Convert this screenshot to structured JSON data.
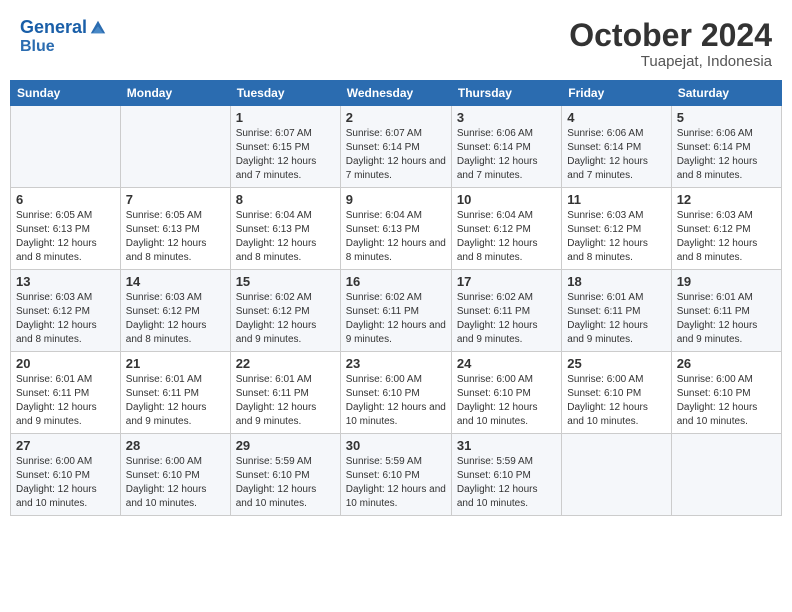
{
  "header": {
    "logo_line1": "General",
    "logo_line2": "Blue",
    "month": "October 2024",
    "location": "Tuapejat, Indonesia"
  },
  "weekdays": [
    "Sunday",
    "Monday",
    "Tuesday",
    "Wednesday",
    "Thursday",
    "Friday",
    "Saturday"
  ],
  "weeks": [
    [
      {
        "day": "",
        "sunrise": "",
        "sunset": "",
        "daylight": ""
      },
      {
        "day": "",
        "sunrise": "",
        "sunset": "",
        "daylight": ""
      },
      {
        "day": "1",
        "sunrise": "Sunrise: 6:07 AM",
        "sunset": "Sunset: 6:15 PM",
        "daylight": "Daylight: 12 hours and 7 minutes."
      },
      {
        "day": "2",
        "sunrise": "Sunrise: 6:07 AM",
        "sunset": "Sunset: 6:14 PM",
        "daylight": "Daylight: 12 hours and 7 minutes."
      },
      {
        "day": "3",
        "sunrise": "Sunrise: 6:06 AM",
        "sunset": "Sunset: 6:14 PM",
        "daylight": "Daylight: 12 hours and 7 minutes."
      },
      {
        "day": "4",
        "sunrise": "Sunrise: 6:06 AM",
        "sunset": "Sunset: 6:14 PM",
        "daylight": "Daylight: 12 hours and 7 minutes."
      },
      {
        "day": "5",
        "sunrise": "Sunrise: 6:06 AM",
        "sunset": "Sunset: 6:14 PM",
        "daylight": "Daylight: 12 hours and 8 minutes."
      }
    ],
    [
      {
        "day": "6",
        "sunrise": "Sunrise: 6:05 AM",
        "sunset": "Sunset: 6:13 PM",
        "daylight": "Daylight: 12 hours and 8 minutes."
      },
      {
        "day": "7",
        "sunrise": "Sunrise: 6:05 AM",
        "sunset": "Sunset: 6:13 PM",
        "daylight": "Daylight: 12 hours and 8 minutes."
      },
      {
        "day": "8",
        "sunrise": "Sunrise: 6:04 AM",
        "sunset": "Sunset: 6:13 PM",
        "daylight": "Daylight: 12 hours and 8 minutes."
      },
      {
        "day": "9",
        "sunrise": "Sunrise: 6:04 AM",
        "sunset": "Sunset: 6:13 PM",
        "daylight": "Daylight: 12 hours and 8 minutes."
      },
      {
        "day": "10",
        "sunrise": "Sunrise: 6:04 AM",
        "sunset": "Sunset: 6:12 PM",
        "daylight": "Daylight: 12 hours and 8 minutes."
      },
      {
        "day": "11",
        "sunrise": "Sunrise: 6:03 AM",
        "sunset": "Sunset: 6:12 PM",
        "daylight": "Daylight: 12 hours and 8 minutes."
      },
      {
        "day": "12",
        "sunrise": "Sunrise: 6:03 AM",
        "sunset": "Sunset: 6:12 PM",
        "daylight": "Daylight: 12 hours and 8 minutes."
      }
    ],
    [
      {
        "day": "13",
        "sunrise": "Sunrise: 6:03 AM",
        "sunset": "Sunset: 6:12 PM",
        "daylight": "Daylight: 12 hours and 8 minutes."
      },
      {
        "day": "14",
        "sunrise": "Sunrise: 6:03 AM",
        "sunset": "Sunset: 6:12 PM",
        "daylight": "Daylight: 12 hours and 8 minutes."
      },
      {
        "day": "15",
        "sunrise": "Sunrise: 6:02 AM",
        "sunset": "Sunset: 6:12 PM",
        "daylight": "Daylight: 12 hours and 9 minutes."
      },
      {
        "day": "16",
        "sunrise": "Sunrise: 6:02 AM",
        "sunset": "Sunset: 6:11 PM",
        "daylight": "Daylight: 12 hours and 9 minutes."
      },
      {
        "day": "17",
        "sunrise": "Sunrise: 6:02 AM",
        "sunset": "Sunset: 6:11 PM",
        "daylight": "Daylight: 12 hours and 9 minutes."
      },
      {
        "day": "18",
        "sunrise": "Sunrise: 6:01 AM",
        "sunset": "Sunset: 6:11 PM",
        "daylight": "Daylight: 12 hours and 9 minutes."
      },
      {
        "day": "19",
        "sunrise": "Sunrise: 6:01 AM",
        "sunset": "Sunset: 6:11 PM",
        "daylight": "Daylight: 12 hours and 9 minutes."
      }
    ],
    [
      {
        "day": "20",
        "sunrise": "Sunrise: 6:01 AM",
        "sunset": "Sunset: 6:11 PM",
        "daylight": "Daylight: 12 hours and 9 minutes."
      },
      {
        "day": "21",
        "sunrise": "Sunrise: 6:01 AM",
        "sunset": "Sunset: 6:11 PM",
        "daylight": "Daylight: 12 hours and 9 minutes."
      },
      {
        "day": "22",
        "sunrise": "Sunrise: 6:01 AM",
        "sunset": "Sunset: 6:11 PM",
        "daylight": "Daylight: 12 hours and 9 minutes."
      },
      {
        "day": "23",
        "sunrise": "Sunrise: 6:00 AM",
        "sunset": "Sunset: 6:10 PM",
        "daylight": "Daylight: 12 hours and 10 minutes."
      },
      {
        "day": "24",
        "sunrise": "Sunrise: 6:00 AM",
        "sunset": "Sunset: 6:10 PM",
        "daylight": "Daylight: 12 hours and 10 minutes."
      },
      {
        "day": "25",
        "sunrise": "Sunrise: 6:00 AM",
        "sunset": "Sunset: 6:10 PM",
        "daylight": "Daylight: 12 hours and 10 minutes."
      },
      {
        "day": "26",
        "sunrise": "Sunrise: 6:00 AM",
        "sunset": "Sunset: 6:10 PM",
        "daylight": "Daylight: 12 hours and 10 minutes."
      }
    ],
    [
      {
        "day": "27",
        "sunrise": "Sunrise: 6:00 AM",
        "sunset": "Sunset: 6:10 PM",
        "daylight": "Daylight: 12 hours and 10 minutes."
      },
      {
        "day": "28",
        "sunrise": "Sunrise: 6:00 AM",
        "sunset": "Sunset: 6:10 PM",
        "daylight": "Daylight: 12 hours and 10 minutes."
      },
      {
        "day": "29",
        "sunrise": "Sunrise: 5:59 AM",
        "sunset": "Sunset: 6:10 PM",
        "daylight": "Daylight: 12 hours and 10 minutes."
      },
      {
        "day": "30",
        "sunrise": "Sunrise: 5:59 AM",
        "sunset": "Sunset: 6:10 PM",
        "daylight": "Daylight: 12 hours and 10 minutes."
      },
      {
        "day": "31",
        "sunrise": "Sunrise: 5:59 AM",
        "sunset": "Sunset: 6:10 PM",
        "daylight": "Daylight: 12 hours and 10 minutes."
      },
      {
        "day": "",
        "sunrise": "",
        "sunset": "",
        "daylight": ""
      },
      {
        "day": "",
        "sunrise": "",
        "sunset": "",
        "daylight": ""
      }
    ]
  ]
}
